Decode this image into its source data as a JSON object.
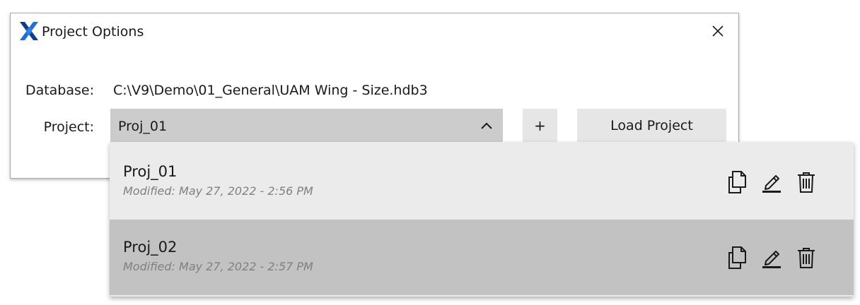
{
  "dialog": {
    "title": "Project Options",
    "logo_icon": "x-logo-icon",
    "close_icon": "close-icon"
  },
  "database": {
    "label": "Database:",
    "path": "C:\\V9\\Demo\\01_General\\UAM Wing - Size.hdb3"
  },
  "project": {
    "label": "Project:",
    "selected": "Proj_01",
    "expanded": true
  },
  "buttons": {
    "add_label": "+",
    "load_label": "Load Project"
  },
  "dropdown": {
    "items": [
      {
        "name": "Proj_01",
        "modified": "Modified: May 27, 2022 - 2:56 PM",
        "actions": [
          "copy-icon",
          "rename-icon",
          "delete-icon"
        ]
      },
      {
        "name": "Proj_02",
        "modified": "Modified: May 27, 2022 - 2:57 PM",
        "actions": [
          "copy-icon",
          "rename-icon",
          "delete-icon"
        ]
      }
    ]
  },
  "colors": {
    "combo_bg": "#cccccc",
    "button_bg": "#e6e6e6",
    "row_bg": "#ebebeb",
    "row_hover_bg": "#c2c2c2",
    "logo_blue": "#1e6fd9",
    "logo_dark": "#0b3d91",
    "muted_text": "#808080"
  }
}
